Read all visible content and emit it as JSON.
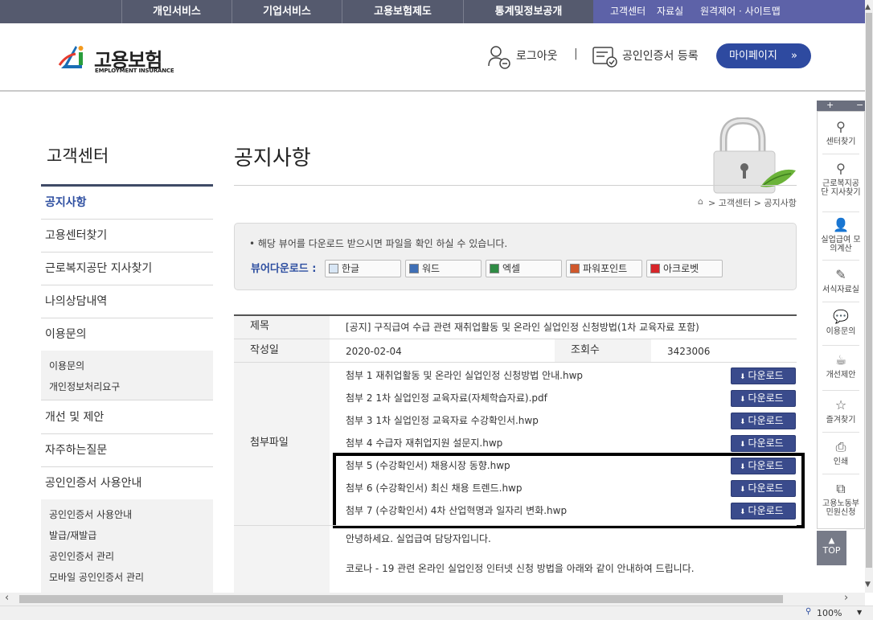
{
  "topnav": {
    "items": [
      "개인서비스",
      "기업서비스",
      "고용보험제도",
      "통계및정보공개"
    ],
    "util": {
      "customer": "고객센터",
      "data": "자료실",
      "remote": "원격제어 · 사이트맵"
    }
  },
  "header": {
    "logo_ko": "고용보험",
    "logo_en": "EMPLOYMENT INSURANCE",
    "logout": "로그아웃",
    "separator": "|",
    "cert_register": "공인인증서 등록",
    "mypage": "마이페이지",
    "mypage_icon": "double-chevron-right-icon"
  },
  "sidebar": {
    "title": "고객센터",
    "items": [
      "공지사항",
      "고용센터찾기",
      "근로복지공단 지사찾기",
      "나의상담내역",
      "이용문의"
    ],
    "sub1": [
      "이용문의",
      "개인정보처리요구"
    ],
    "items2": [
      "개선 및 제안",
      "자주하는질문",
      "공인인증서 사용안내"
    ],
    "sub2": [
      "공인인증서 사용안내",
      "발급/재발급",
      "공인인증서 관리",
      "모바일 공인인증서 관리"
    ]
  },
  "main": {
    "title": "공지사항",
    "breadcrumb": "> 고객센터 > 공지사항",
    "viewer_note": "• 해당 뷰어를 다운로드 받으시면 파일을 확인 하실 수 있습니다.",
    "viewer_label": "뷰어다운로드 :",
    "viewers": [
      "한글",
      "워드",
      "엑셀",
      "파워포인트",
      "아크로벳"
    ]
  },
  "notice": {
    "subject_label": "제목",
    "subject": "[공지] 구직급여 수급 관련 재취업활동 및 온라인 실업인정 신청방법(1차 교육자료 포함)",
    "date_label": "작성일",
    "date": "2020-02-04",
    "views_label": "조회수",
    "views": "3423006",
    "attach_label": "첨부파일",
    "attachments": [
      "첨부 1 재취업활동 및 온라인 실업인정 신청방법 안내.hwp",
      "첨부 2 1차 실업인정 교육자료(자체학습자료).pdf",
      "첨부 3 1차 실업인정 교육자료 수강확인서.hwp",
      "첨부 4 수급자 재취업지원 설문지.hwp",
      "첨부 5 (수강확인서) 채용시장 동향.hwp",
      "첨부 6 (수강확인서) 최신 채용 트렌드.hwp",
      "첨부 7 (수강확인서) 4차 산업혁명과 일자리 변화.hwp"
    ],
    "download_label": "다운로드",
    "body": [
      "안녕하세요. 실업급여 담당자입니다.",
      "코로나 - 19 관련 온라인 실업인정 인터넷 신청 방법을 아래와 같이 안내하여 드립니다."
    ]
  },
  "quickmenu": {
    "plus": "+",
    "minus": "−",
    "items": [
      "센터찾기",
      "근로복지공단 지사찾기",
      "실업급여 모의계산",
      "서식자료실",
      "이용문의",
      "개선제안",
      "즐겨찾기",
      "인쇄",
      "고용노동부 민원신청"
    ],
    "top": "TOP"
  },
  "status": {
    "zoom": "100%"
  }
}
